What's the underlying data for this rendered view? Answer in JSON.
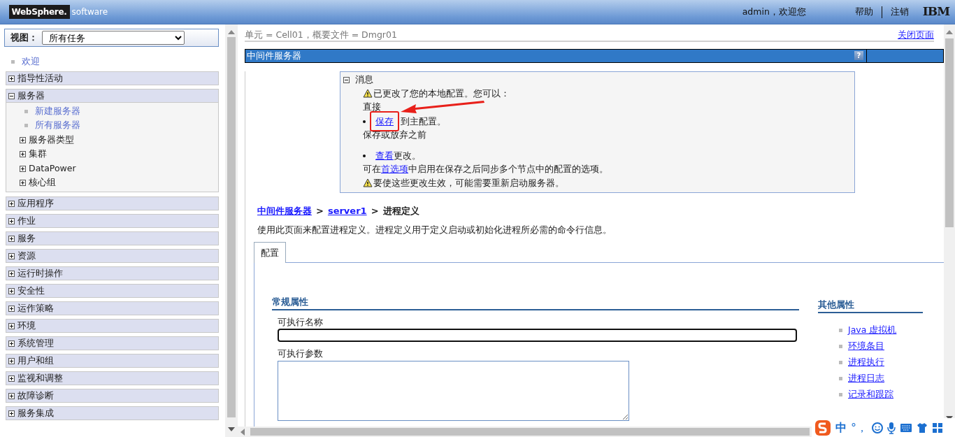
{
  "header": {
    "brand": "WebSphere.",
    "brand_suffix": "software",
    "welcome": "admin，欢迎您",
    "links": [
      "帮助",
      "注销"
    ],
    "logo": "IBM"
  },
  "sidebar": {
    "view_label": "视图：",
    "view_value": "所有任务",
    "welcome_link": "欢迎",
    "sections": [
      {
        "label": "指导性活动",
        "expanded": false
      },
      {
        "label": "服务器",
        "expanded": true,
        "links": [
          "新建服务器",
          "所有服务器"
        ],
        "children": [
          {
            "label": "服务器类型",
            "expanded": false
          },
          {
            "label": "集群",
            "expanded": false
          },
          {
            "label": "DataPower",
            "expanded": false
          },
          {
            "label": "核心组",
            "expanded": false
          }
        ]
      },
      {
        "label": "应用程序",
        "expanded": false
      },
      {
        "label": "作业",
        "expanded": false
      },
      {
        "label": "服务",
        "expanded": false
      },
      {
        "label": "资源",
        "expanded": false
      },
      {
        "label": "运行时操作",
        "expanded": false
      },
      {
        "label": "安全性",
        "expanded": false
      },
      {
        "label": "运作策略",
        "expanded": false
      },
      {
        "label": "环境",
        "expanded": false
      },
      {
        "label": "系统管理",
        "expanded": false
      },
      {
        "label": "用户和组",
        "expanded": false
      },
      {
        "label": "监视和调整",
        "expanded": false
      },
      {
        "label": "故障诊断",
        "expanded": false
      },
      {
        "label": "服务集成",
        "expanded": false
      }
    ]
  },
  "content": {
    "scope": "单元 = Cell01，概要文件 = Dmgr01",
    "close_link": "关闭页面",
    "panel_title": "中间件服务器",
    "help_glyph": "?",
    "messages": {
      "title": "消息",
      "expanded": true,
      "lines": [
        {
          "kind": "warning",
          "parts": [
            {
              "kind": "text",
              "text": "已更改了您的本地配置。您可以："
            }
          ]
        },
        {
          "kind": "plain",
          "parts": [
            {
              "kind": "text",
              "text": "直接"
            }
          ]
        },
        {
          "kind": "bullet",
          "highlighted": true,
          "parts": [
            {
              "kind": "link",
              "text": "保存"
            },
            {
              "kind": "text",
              "text": "到主配置。"
            }
          ]
        },
        {
          "kind": "plain",
          "parts": [
            {
              "kind": "text",
              "text": "保存或放弃之前"
            }
          ]
        },
        {
          "kind": "bullet",
          "parts": [
            {
              "kind": "link",
              "text": "查看"
            },
            {
              "kind": "text",
              "text": "更改。"
            }
          ]
        },
        {
          "kind": "plain",
          "parts": [
            {
              "kind": "text",
              "text": "可在"
            },
            {
              "kind": "link",
              "text": "首选项"
            },
            {
              "kind": "text",
              "text": "中启用在保存之后同步多个节点中的配置的选项。"
            }
          ]
        },
        {
          "kind": "warning",
          "parts": [
            {
              "kind": "text",
              "text": "要使这些更改生效，可能需要重新启动服务器。"
            }
          ]
        }
      ]
    },
    "breadcrumb": {
      "links": [
        "中间件服务器",
        "server1"
      ],
      "separator": ">",
      "current": "进程定义"
    },
    "description": "使用此页面来配置进程定义。进程定义用于定义启动或初始化进程所必需的命令行信息。",
    "tabs": [
      {
        "label": "配置",
        "selected": true
      }
    ],
    "general": {
      "title": "常规属性",
      "fields": [
        {
          "label": "可执行名称",
          "kind": "text"
        },
        {
          "label": "可执行参数",
          "kind": "textarea"
        }
      ]
    },
    "additional": {
      "title": "其他属性",
      "links": [
        "Java 虚拟机",
        "环境条目",
        "进程执行",
        "进程日志",
        "记录和跟踪"
      ]
    }
  },
  "ime_toolbar": {
    "mode": "中",
    "punctuation": "°，"
  }
}
